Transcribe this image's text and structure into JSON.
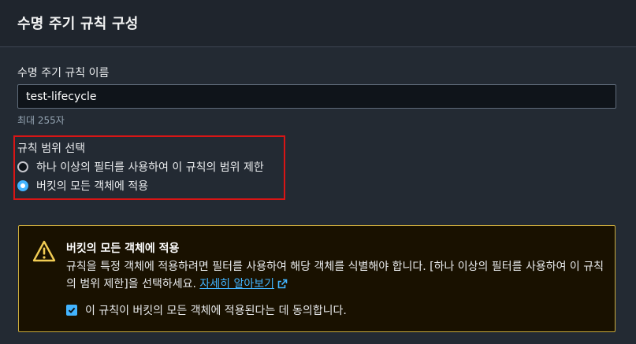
{
  "header": {
    "title": "수명 주기 규칙 구성"
  },
  "rule_name": {
    "label": "수명 주기 규칙 이름",
    "value": "test-lifecycle",
    "constraint": "최대 255자"
  },
  "rule_scope": {
    "label": "규칙 범위 선택",
    "options": [
      {
        "label": "하나 이상의 필터를 사용하여 이 규칙의 범위 제한",
        "selected": false
      },
      {
        "label": "버킷의 모든 객체에 적용",
        "selected": true
      }
    ]
  },
  "warning": {
    "icon": "warning-icon",
    "title": "버킷의 모든 객체에 적용",
    "body": "규칙을 특정 객체에 적용하려면 필터를 사용하여 해당 객체를 식별해야 합니다. [하나 이상의 필터를 사용하여 이 규칙의 범위 제한]을 선택하세요.",
    "link_text": "자세히 알아보기",
    "link_icon": "external-link-icon",
    "acknowledge_label": "이 규칙이 버킷의 모든 객체에 적용된다는 데 동의합니다.",
    "acknowledged": true
  },
  "colors": {
    "accent": "#42b4ff",
    "highlight_border": "#d91515",
    "warning_border": "#c9aa3c",
    "warning_background": "#191100"
  }
}
